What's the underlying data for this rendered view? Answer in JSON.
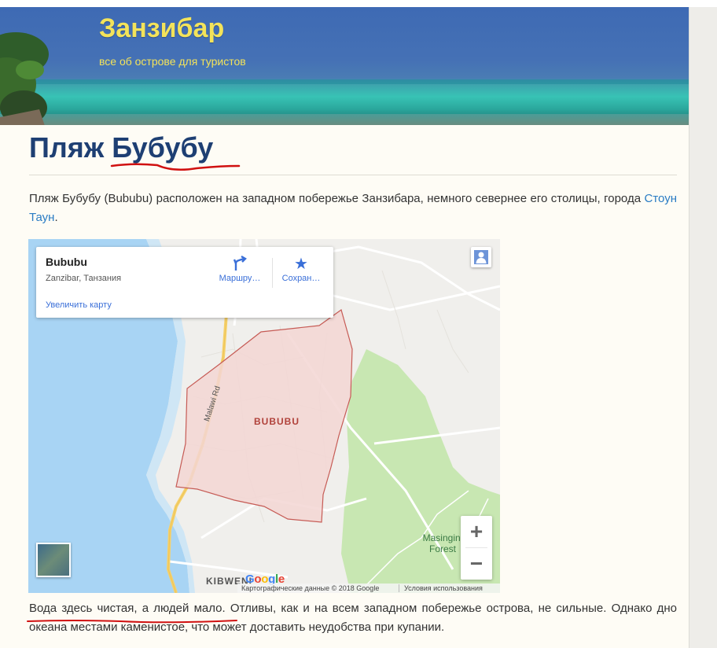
{
  "site": {
    "title": "Занзибар",
    "tagline": "все об острове для туристов"
  },
  "post": {
    "title": "Пляж Бубубу",
    "intro_text": "Пляж Бубубу (Bububu) расположен на западном побережье Занзибара, немного севернее его столицы, города ",
    "intro_link": "Стоун Таун",
    "intro_end": ".",
    "body_text": "Вода здесь чистая, а людей мало. Отливы, как и на всем западном побережье острова, не сильные. Однако дно океана местами каменистое, что может доставить неудобства при купании."
  },
  "map": {
    "place_name": "Bububu",
    "place_address": "Zanzibar, Танзания",
    "enlarge_label": "Увеличить карту",
    "route_label": "Маршру…",
    "save_label": "Сохран…",
    "area_label": "BUBUBU",
    "road_label": "Malawi Rd",
    "forest_label_1": "Masingini",
    "forest_label_2": "Forest",
    "town_label": "KIBWENI",
    "zoom_in_label": "+",
    "zoom_out_label": "−",
    "attribution": "Картографические данные © 2018 Google",
    "terms": "Условия использования",
    "logo": [
      "G",
      "o",
      "o",
      "g",
      "l",
      "e"
    ]
  },
  "icons": {
    "route": "directions-icon",
    "save": "star-icon",
    "person": "pegman-icon",
    "satellite": "satellite-thumbnail"
  },
  "colors": {
    "title_yellow": "#f3e35a",
    "post_title": "#1e3f73",
    "link": "#2a7cc4",
    "map_water": "#a8d4f4",
    "map_park": "#c8e7b2",
    "map_area_fill": "#f3d6d3",
    "map_area_border": "#c65b55",
    "annotation_red": "#d01010"
  }
}
